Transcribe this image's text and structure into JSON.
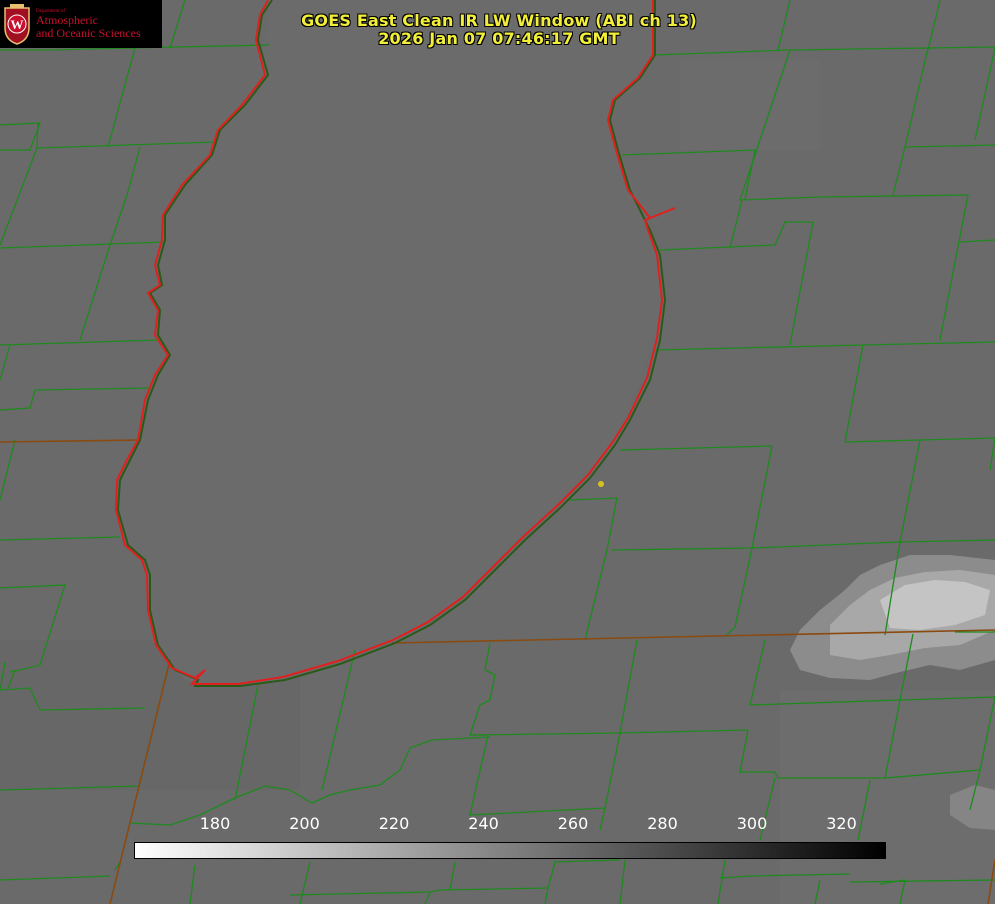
{
  "logo": {
    "department": "Department of",
    "line1": "Atmospheric",
    "line2": "and Oceanic Sciences",
    "crest_letter": "W"
  },
  "title": {
    "line1": "GOES East Clean IR LW Window (ABI ch 13)",
    "line2": "2026 Jan 07 07:46:17 GMT"
  },
  "colorbar": {
    "ticks": [
      "180",
      "200",
      "220",
      "240",
      "260",
      "280",
      "300",
      "320"
    ],
    "gradient_start": "#ffffff",
    "gradient_end": "#000000"
  },
  "colors": {
    "background": "#6a6a6a",
    "lake_fill": "#6c6c6c",
    "county_lines": "#1e8a1e",
    "coast_red": "#e0201e",
    "state_line": "#8a4a10",
    "title_yellow": "#f2ef3a",
    "cloud": "#c8c8c8",
    "marker": "#d8c020"
  },
  "icons": {
    "location_marker": "yellow-dot-marker",
    "logo": "uw-crest-icon"
  }
}
